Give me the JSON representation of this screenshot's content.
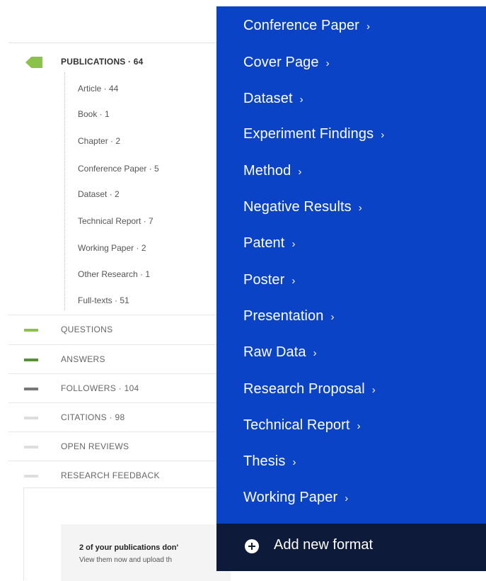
{
  "sidebar": {
    "publications": {
      "label": "PUBLICATIONS · 64",
      "marker_color": "#8bc34a"
    },
    "sub_items": [
      "Article · 44",
      "Book · 1",
      "Chapter · 2",
      "Conference Paper · 5",
      "Dataset · 2",
      "Technical Report · 7",
      "Working Paper · 2",
      "Other Research · 1",
      "Full-texts · 51"
    ],
    "sections": [
      {
        "label": "QUESTIONS",
        "color": "#8bc34a"
      },
      {
        "label": "ANSWERS",
        "color": "#5a8f3a"
      },
      {
        "label": "FOLLOWERS · 104",
        "color": "#777777"
      },
      {
        "label": "CITATIONS · 98",
        "color": "#dddddd"
      },
      {
        "label": "OPEN REVIEWS",
        "color": "#dddddd"
      },
      {
        "label": "RESEARCH FEEDBACK",
        "color": "#dddddd"
      }
    ]
  },
  "notice": {
    "title_bold": "2 of your publications don'",
    "subtitle": "View them now and upload th"
  },
  "format_menu": {
    "bg_color": "#0a43c6",
    "items": [
      "Conference Paper",
      "Cover Page",
      "Dataset",
      "Experiment Findings",
      "Method",
      "Negative Results",
      "Patent",
      "Poster",
      "Presentation",
      "Raw Data",
      "Research Proposal",
      "Technical Report",
      "Thesis",
      "Working Paper"
    ],
    "chevron": "›",
    "add_label": "Add new format",
    "footer_color": "#0d1a3a"
  }
}
